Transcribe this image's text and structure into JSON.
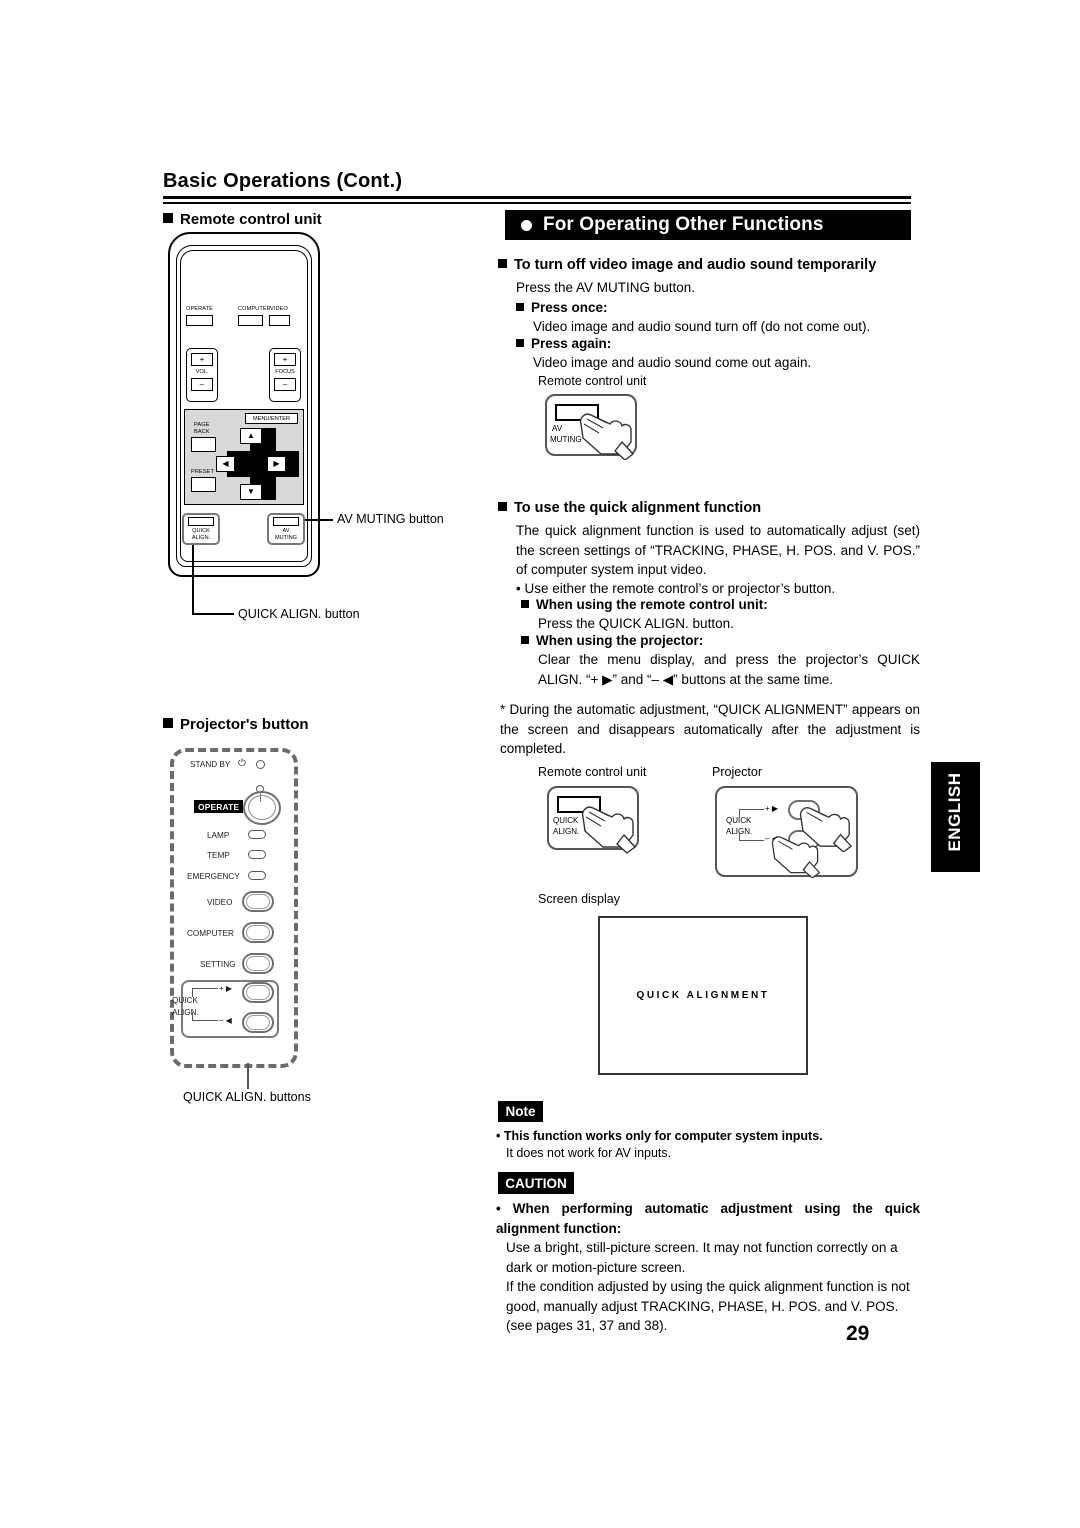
{
  "page": {
    "title": "Basic Operations (Cont.)",
    "number": "29",
    "side_tab": "ENGLISH"
  },
  "left_column": {
    "remote_heading": "Remote control unit",
    "projector_heading": "Projector's button",
    "callouts": {
      "av_muting": "AV MUTING button",
      "quick_align": "QUICK ALIGN. button",
      "quick_align_buttons": "QUICK ALIGN. buttons"
    },
    "remote_buttons": {
      "operate": "OPERATE",
      "computer": "COMPUTER",
      "video": "VIDEO",
      "vol": "VOL.",
      "focus": "FOCUS",
      "plus": "+",
      "minus": "–",
      "page_back_line1": "PAGE",
      "page_back_line2": "BACK",
      "preset": "PRESET",
      "menu_enter": "MENU/ENTER",
      "quick_align_line1": "QUICK",
      "quick_align_line2": "ALIGN.",
      "av_muting_line1": "AV",
      "av_muting_line2": "MUTING",
      "up": "▲",
      "down": "▼",
      "left": "◀",
      "right": "▶"
    },
    "projector_panel": {
      "stand_by": "STAND BY",
      "power_glyph": "⏻",
      "operate": "OPERATE",
      "lamp": "LAMP",
      "temp": "TEMP",
      "emergency": "EMERGENCY",
      "video": "VIDEO",
      "computer": "COMPUTER",
      "setting": "SETTING",
      "quick_line1": "QUICK",
      "quick_line2": "ALIGN.",
      "plus_right": "+ ▶",
      "minus_left": "– ◀"
    }
  },
  "right_column": {
    "banner": "For Operating Other Functions",
    "section1": {
      "heading": "To turn off video image and audio sound temporarily",
      "intro": "Press the AV MUTING button.",
      "items": [
        {
          "label": "Press once:",
          "text": "Video image and audio sound turn off (do not come out)."
        },
        {
          "label": "Press again:",
          "text": "Video image and audio sound come out again."
        }
      ],
      "figure_caption": "Remote control unit",
      "figure_button_line1": "AV",
      "figure_button_line2": "MUTING"
    },
    "section2": {
      "heading": "To use the quick alignment function",
      "paragraph": "The quick alignment function is used to automatically adjust (set) the screen settings of “TRACKING, PHASE, H. POS. and V. POS.” of computer system input video.",
      "bullet": "• Use either the remote control’s or projector’s button.",
      "items": [
        {
          "label": "When using the remote control unit:",
          "text": "Press the QUICK ALIGN. button."
        },
        {
          "label": "When using the projector:",
          "text": "Clear the menu display, and press the projector’s QUICK ALIGN. “+ ▶” and “– ◀” buttons at the same time."
        }
      ],
      "asterisk_note": "* During the automatic adjustment, “QUICK ALIGNMENT” appears on the screen and disappears automatically after the adjustment is completed.",
      "fig_caption_remote": "Remote control unit",
      "fig_caption_projector": "Projector",
      "fig_remote_btn_line1": "QUICK",
      "fig_remote_btn_line2": "ALIGN.",
      "fig_proj_line1": "QUICK",
      "fig_proj_line2": "ALIGN.",
      "fig_proj_plus": "+ ▶",
      "fig_proj_minus": "– ◀",
      "screen_caption": "Screen display",
      "screen_text": "QUICK ALIGNMENT"
    },
    "note": {
      "tag": "Note",
      "bullet_bold": "• This function works only for computer system inputs.",
      "body": "It does not work for AV inputs."
    },
    "caution": {
      "tag": "CAUTION",
      "bullet_bold": "• When performing automatic adjustment using the quick alignment function:",
      "para1": "Use a bright, still-picture screen. It may not function correctly on a dark or motion-picture screen.",
      "para2": "If the condition adjusted by using the quick alignment function is not good, manually adjust TRACKING, PHASE, H. POS. and V. POS. (see pages 31, 37 and 38)."
    }
  }
}
